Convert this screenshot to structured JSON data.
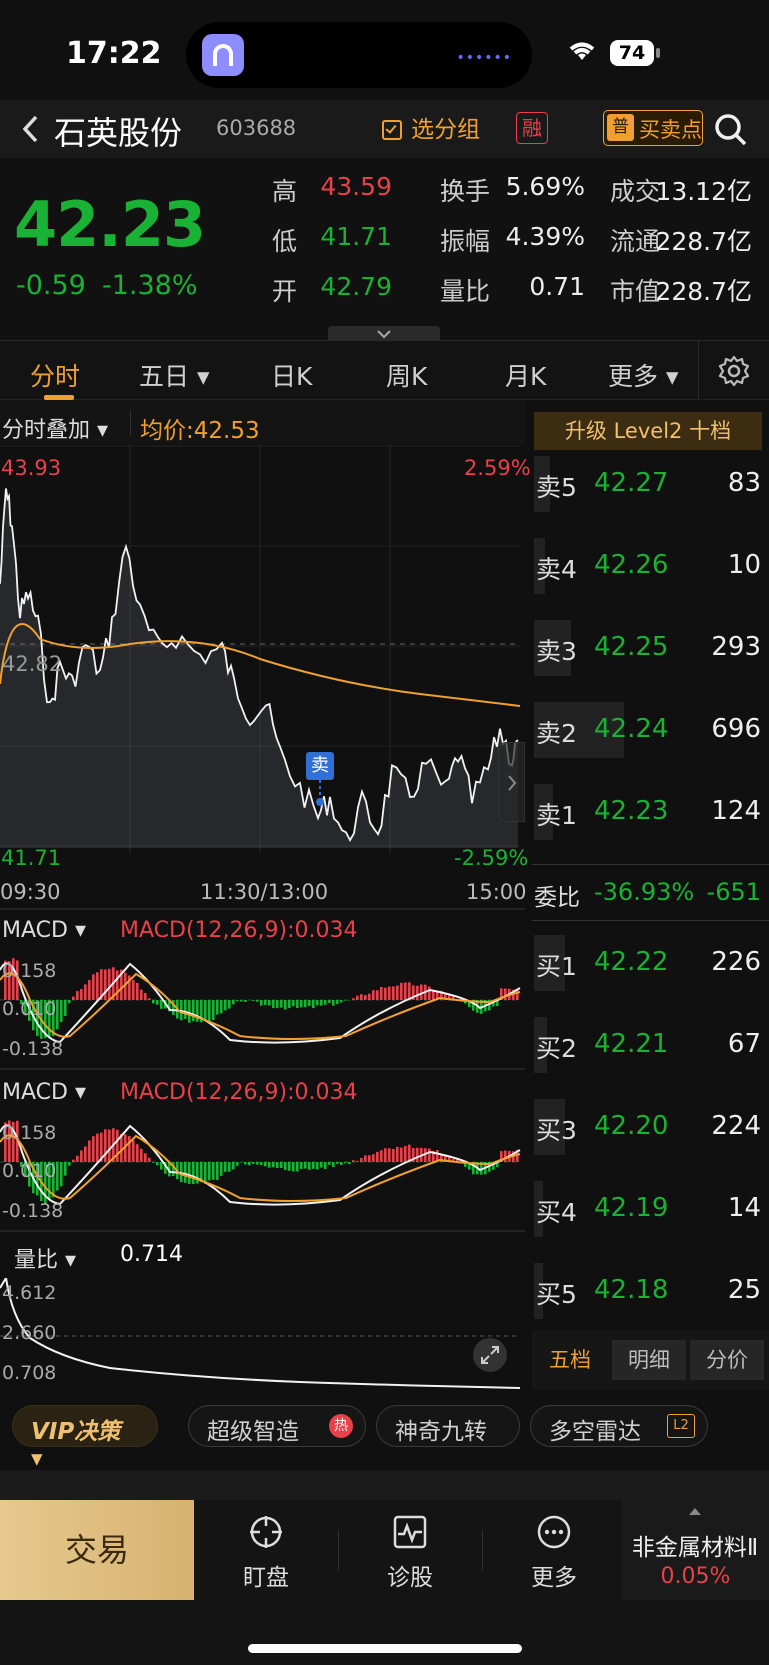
{
  "status": {
    "time": "17:22",
    "battery": "74"
  },
  "header": {
    "back_icon": "chevron-left-icon",
    "name": "石英股份",
    "code": "603688",
    "group_button": "选分组",
    "margin_badge": "融",
    "buy_sell_badge_icon": "普",
    "buy_sell_label": "买卖点",
    "search_icon": "search-icon"
  },
  "quote": {
    "price": "42.23",
    "change": "-0.59",
    "change_pct": "-1.38%",
    "stats": [
      {
        "label": "高",
        "value": "43.59",
        "color": "red"
      },
      {
        "label": "换手",
        "value": "5.69%"
      },
      {
        "label": "成交",
        "value": "13.12亿"
      },
      {
        "label": "低",
        "value": "41.71",
        "color": "green"
      },
      {
        "label": "振幅",
        "value": "4.39%"
      },
      {
        "label": "流通",
        "value": "228.7亿"
      },
      {
        "label": "开",
        "value": "42.79",
        "color": "green"
      },
      {
        "label": "量比",
        "value": "0.71"
      },
      {
        "label": "市值",
        "value": "228.7亿"
      }
    ]
  },
  "tabs": [
    {
      "label": "分时",
      "active": true
    },
    {
      "label": "五日 ▾"
    },
    {
      "label": "日K"
    },
    {
      "label": "周K"
    },
    {
      "label": "月K"
    },
    {
      "label": "更多 ▾"
    }
  ],
  "intraday": {
    "overlay_label": "分时叠加 ▾",
    "avg_label": "均价:",
    "avg_value": "42.53",
    "y_high": "43.93",
    "y_mid": "42.82",
    "y_low": "41.71",
    "pct_high": "2.59%",
    "pct_low": "-2.59%",
    "time_start": "09:30",
    "time_mid": "11:30/13:00",
    "time_end": "15:00",
    "sell_marker": "卖"
  },
  "macd1": {
    "name": "MACD ▾",
    "params": "MACD(12,26,9):0.034",
    "top": "0.158",
    "mid": "0.010",
    "bottom": "-0.138"
  },
  "macd2": {
    "name": "MACD ▾",
    "params": "MACD(12,26,9):0.034",
    "top": "0.158",
    "mid": "0.010",
    "bottom": "-0.138"
  },
  "volratio": {
    "name": "量比 ▾",
    "value": "0.714",
    "top": "4.612",
    "mid": "2.660",
    "bottom": "0.708"
  },
  "orderbook": {
    "upgrade": "升级 Level2 十档",
    "asks": [
      {
        "label": "卖5",
        "price": "42.27",
        "vol": "83",
        "bar": 0.14
      },
      {
        "label": "卖4",
        "price": "42.26",
        "vol": "10",
        "bar": 0.08
      },
      {
        "label": "卖3",
        "price": "42.25",
        "vol": "293",
        "bar": 0.38
      },
      {
        "label": "卖2",
        "price": "42.24",
        "vol": "696",
        "bar": 1.0
      },
      {
        "label": "卖1",
        "price": "42.23",
        "vol": "124",
        "bar": 0.18
      }
    ],
    "ratio_label": "委比",
    "ratio_pct": "-36.93%",
    "ratio_vol": "-651",
    "bids": [
      {
        "label": "买1",
        "price": "42.22",
        "vol": "226",
        "bar": 0.31
      },
      {
        "label": "买2",
        "price": "42.21",
        "vol": "67",
        "bar": 0.1
      },
      {
        "label": "买3",
        "price": "42.20",
        "vol": "224",
        "bar": 0.31
      },
      {
        "label": "买4",
        "price": "42.19",
        "vol": "14",
        "bar": 0.06
      },
      {
        "label": "买5",
        "price": "42.18",
        "vol": "25",
        "bar": 0.06
      }
    ],
    "subtabs": [
      "五档",
      "明细",
      "分价"
    ]
  },
  "tags": [
    {
      "label": "VIP决策 ▾"
    },
    {
      "label": "超级智造",
      "badge": "热"
    },
    {
      "label": "神奇九转"
    },
    {
      "label": "多空雷达",
      "badge": "L2"
    }
  ],
  "bottom": {
    "trade": "交易",
    "items": [
      {
        "label": "盯盘",
        "icon": "crosshair-icon"
      },
      {
        "label": "诊股",
        "icon": "pulse-icon"
      },
      {
        "label": "更多",
        "icon": "more-dots-icon"
      }
    ],
    "sector_name": "非金属材料Ⅱ",
    "sector_change": "0.05%"
  },
  "colors": {
    "red": "#e8414b",
    "green": "#19b235",
    "orange": "#f0a030",
    "bg": "#101010"
  }
}
